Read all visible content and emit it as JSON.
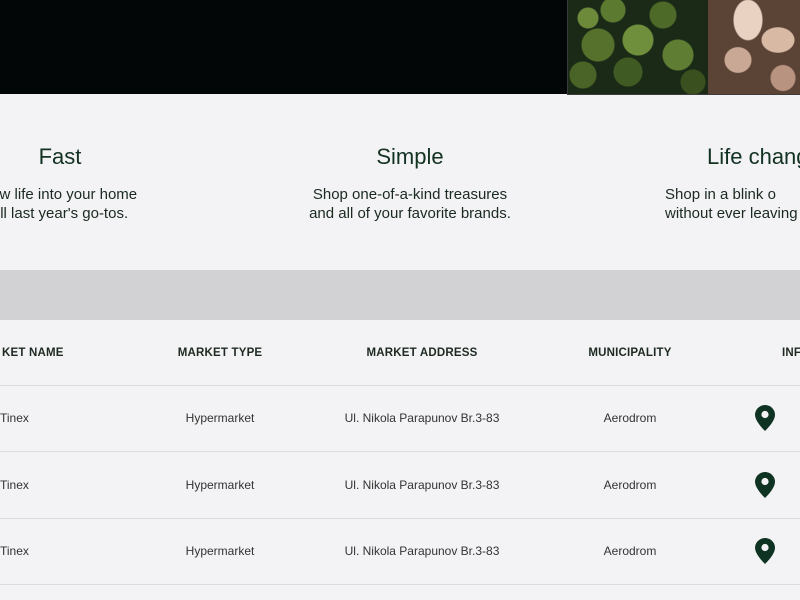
{
  "features": [
    {
      "title": "Fast",
      "lines": [
        "new life into your home",
        "ell last year's go-tos."
      ]
    },
    {
      "title": "Simple",
      "lines": [
        "Shop one-of-a-kind treasures",
        "and all of your favorite brands."
      ]
    },
    {
      "title": "Life chang",
      "lines": [
        "Shop in a blink o",
        "without ever leaving"
      ]
    }
  ],
  "table": {
    "headers": [
      "KET NAME",
      "MARKET TYPE",
      "MARKET ADDRESS",
      "MUNICIPALITY",
      "INF"
    ],
    "rows": [
      {
        "name": "Tinex",
        "type": "Hypermarket",
        "address": "Ul. Nikola Parapunov Br.3-83",
        "municipality": "Aerodrom",
        "info_icon": "map-pin-icon"
      },
      {
        "name": "Tinex",
        "type": "Hypermarket",
        "address": "Ul. Nikola Parapunov Br.3-83",
        "municipality": "Aerodrom",
        "info_icon": "map-pin-icon"
      },
      {
        "name": "Tinex",
        "type": "Hypermarket",
        "address": "Ul. Nikola Parapunov Br.3-83",
        "municipality": "Aerodrom",
        "info_icon": "map-pin-icon"
      }
    ]
  },
  "colors": {
    "accent": "#0f3322",
    "hero_bg": "#020606",
    "page_bg": "#f3f2f4",
    "band": "#d2d1d4"
  }
}
